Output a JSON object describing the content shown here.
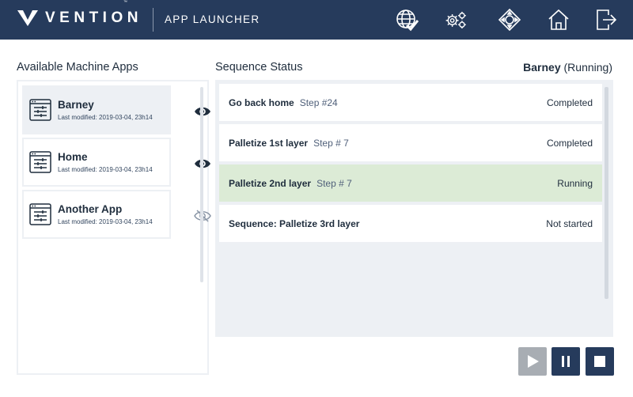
{
  "header": {
    "brand": "VENTION",
    "trademark": "™",
    "title": "APP LAUNCHER",
    "icons": [
      "network-check-icon",
      "settings-gears-icon",
      "jog-controls-icon",
      "home-icon",
      "logout-icon"
    ]
  },
  "apps_panel": {
    "title": "Available Machine Apps",
    "apps": [
      {
        "name": "Barney",
        "modified": "Last modified: 2019-03-04, 23h14",
        "visible": true,
        "selected": true
      },
      {
        "name": "Home",
        "modified": "Last modified: 2019-03-04, 23h14",
        "visible": true,
        "selected": false
      },
      {
        "name": "Another App",
        "modified": "Last modified: 2019-03-04, 23h14",
        "visible": false,
        "selected": false
      }
    ]
  },
  "sequence_panel": {
    "title": "Sequence Status",
    "machine_name": "Barney",
    "machine_state": "(Running)",
    "steps": [
      {
        "name": "Go back home",
        "step": "Step #24",
        "status": "Completed",
        "state": "completed"
      },
      {
        "name": "Palletize 1st layer",
        "step": "Step # 7",
        "status": "Completed",
        "state": "completed"
      },
      {
        "name": "Palletize 2nd layer",
        "step": "Step # 7",
        "status": "Running",
        "state": "running"
      },
      {
        "name": "Sequence: Palletize 3rd layer",
        "step": "",
        "status": "Not started",
        "state": "not-started"
      }
    ]
  },
  "controls": {
    "play": {
      "icon": "play-icon",
      "enabled": false
    },
    "pause": {
      "icon": "pause-icon",
      "enabled": true
    },
    "stop": {
      "icon": "stop-icon",
      "enabled": true
    }
  },
  "colors": {
    "header_bg": "#263b5c",
    "panel_bg": "#edf0f4",
    "running_row": "#dcebd6",
    "disabled_button": "#a8adb3"
  }
}
